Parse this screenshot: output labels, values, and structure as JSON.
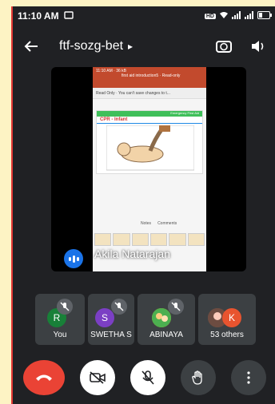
{
  "status_bar": {
    "time": "11:10 AM",
    "hd_badge": "HD"
  },
  "header": {
    "title": "ftf-sozg-bet",
    "title_chevron": "▸",
    "back_icon": "arrow-left-icon",
    "switch_camera_icon": "switch-camera-icon",
    "speaker_icon": "volume-icon"
  },
  "main_video": {
    "speaker_name": "Akila Natarajan",
    "shared_screen": {
      "topbar_text": "11:10 AM · 36 kB",
      "doc_title": "first aid introduction5 · Read-only",
      "readonly_banner": "Read Only · You can't save changes to t...",
      "slide_header": "Emergency First Aid",
      "slide_title": "CPR - Infant",
      "notes_label": "Notes",
      "comments_label": "Comments"
    }
  },
  "participants": [
    {
      "label": "You",
      "initial": "R",
      "avatar_color": "#188038",
      "muted": true
    },
    {
      "label": "SWETHA S",
      "initial": "S",
      "avatar_color": "#7b3fc4",
      "muted": true
    },
    {
      "label": "ABINAYA",
      "initial": "",
      "avatar_color": "#f4b400",
      "muted": true
    },
    {
      "label": "53 others",
      "initial": "K",
      "avatar_color": "#e8542f",
      "muted": false
    }
  ],
  "controls": {
    "hangup_icon": "phone-hangup-icon",
    "camera_icon": "camera-off-icon",
    "mic_icon": "mic-off-icon",
    "hand_icon": "raise-hand-icon",
    "more_icon": "more-vertical-icon"
  },
  "colors": {
    "background": "#202124",
    "hangup": "#ea4335",
    "accent": "#1a73e8",
    "tile": "#3c4043"
  }
}
